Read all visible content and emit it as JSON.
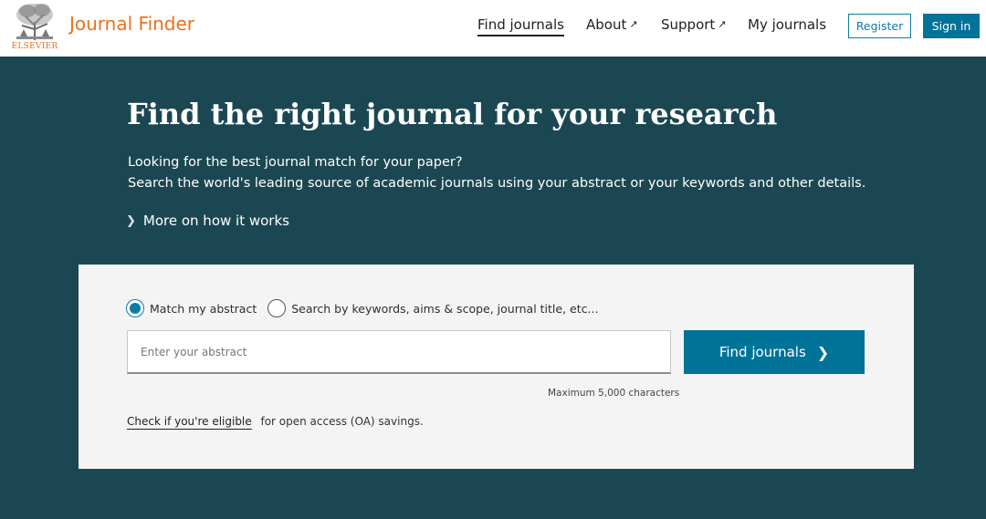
{
  "header": {
    "logo_text": "ELSEVIER",
    "brand": "Journal Finder",
    "nav": {
      "find_journals": "Find journals",
      "about": "About",
      "support": "Support",
      "my_journals": "My journals"
    },
    "external_arrow": "↗",
    "register": "Register",
    "sign_in": "Sign in"
  },
  "hero": {
    "title": "Find the right journal for your research",
    "subtitle_line1": "Looking for the best journal match for your paper?",
    "subtitle_line2": "Search the world's leading source of academic journals using your abstract or your keywords and other details.",
    "more_link": "More on how it works"
  },
  "search": {
    "mode_abstract": "Match my abstract",
    "mode_keywords": "Search by keywords, aims & scope, journal title, etc...",
    "selected_mode": "Match my abstract",
    "abstract_placeholder": "Enter your abstract",
    "abstract_value": "",
    "submit_label": "Find journals",
    "max_chars": "Maximum 5,000 characters",
    "oa_link": "Check if you're eligible",
    "oa_text": "for open access (OA) savings."
  },
  "colors": {
    "hero_bg": "#1b4752",
    "brand_orange": "#e9711c",
    "primary_blue": "#007398",
    "panel_bg": "#f4f4f4"
  },
  "icons": {
    "external_link": "arrow-up-right-icon",
    "chevron": "chevron-right-icon",
    "logo": "elsevier-tree-logo"
  }
}
